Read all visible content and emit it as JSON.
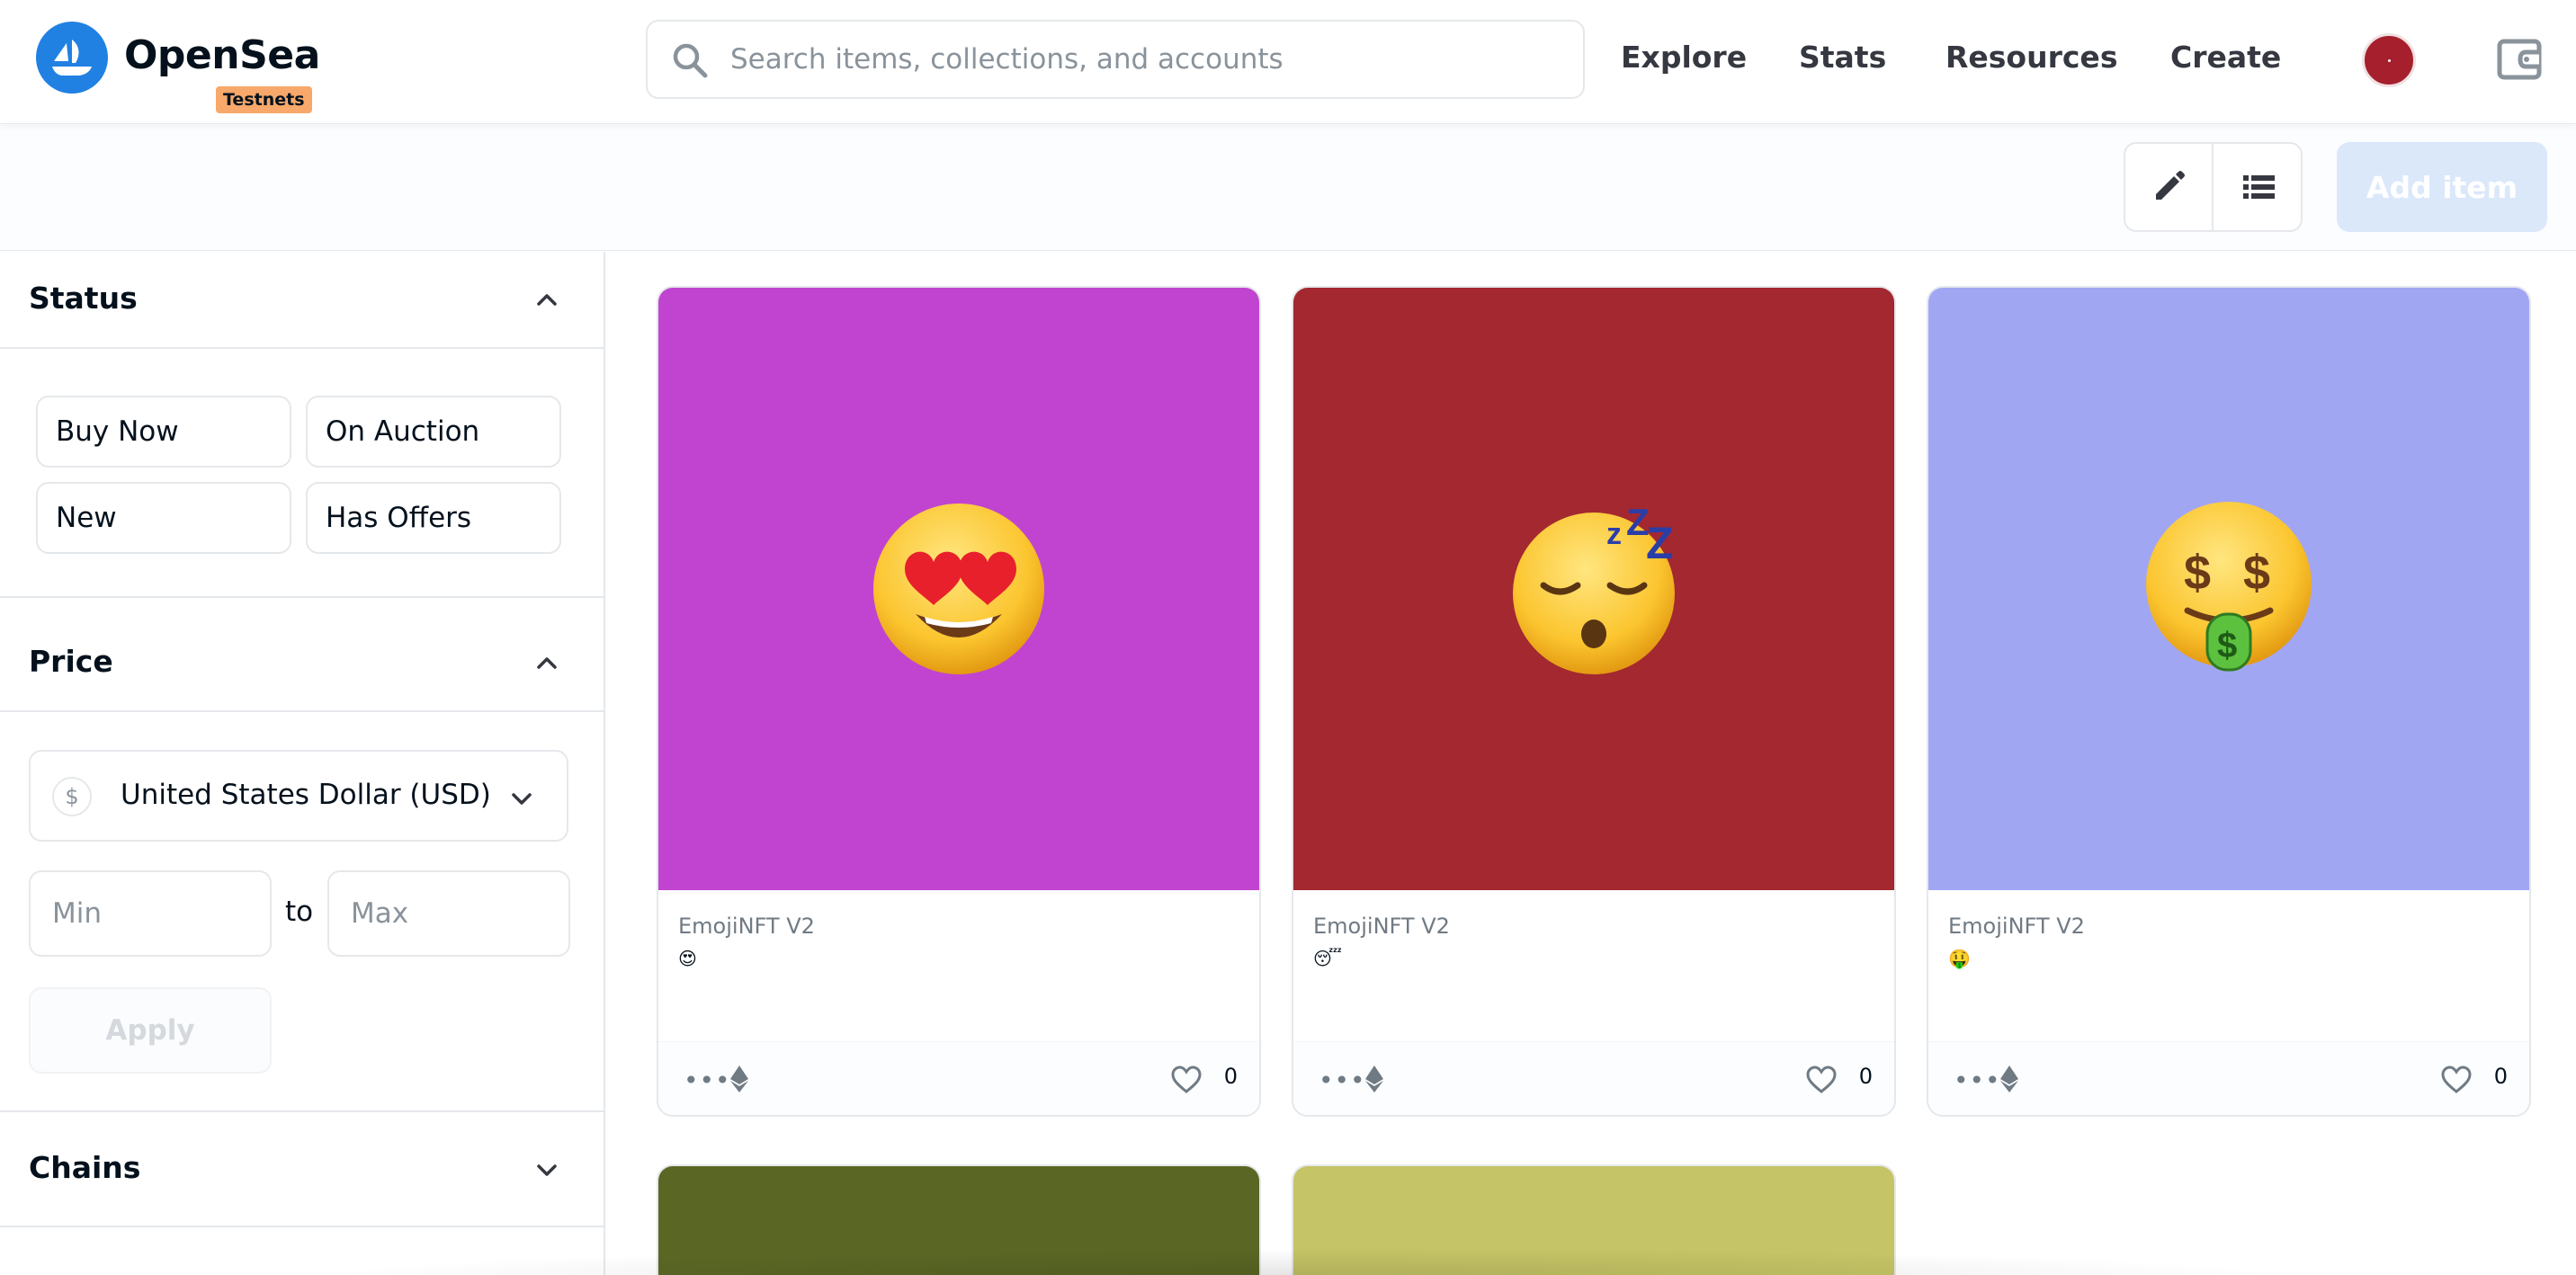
{
  "header": {
    "brand": "OpenSea",
    "badge": "Testnets",
    "search_placeholder": "Search items, collections, and accounts",
    "nav": [
      "Explore",
      "Stats",
      "Resources",
      "Create"
    ]
  },
  "toolbar": {
    "add_item_label": "Add item"
  },
  "sidebar": {
    "status": {
      "title": "Status",
      "options": [
        "Buy Now",
        "On Auction",
        "New",
        "Has Offers"
      ]
    },
    "price": {
      "title": "Price",
      "currency_symbol": "$",
      "currency": "United States Dollar (USD)",
      "min_placeholder": "Min",
      "max_placeholder": "Max",
      "to_label": "to",
      "apply_label": "Apply"
    },
    "chains": {
      "title": "Chains"
    }
  },
  "items": [
    {
      "collection": "EmojiNFT V2",
      "token": "😍",
      "likes": "0",
      "color": "#c044cf",
      "emoji": "heart-eyes"
    },
    {
      "collection": "EmojiNFT V2",
      "token": "😴",
      "likes": "0",
      "color": "#a3282f",
      "emoji": "sleeping"
    },
    {
      "collection": "EmojiNFT V2",
      "token": "🤑",
      "likes": "0",
      "color": "#a1a6f3",
      "emoji": "money-mouth"
    },
    {
      "color": "#5a6724"
    },
    {
      "color": "#c5c466"
    }
  ]
}
